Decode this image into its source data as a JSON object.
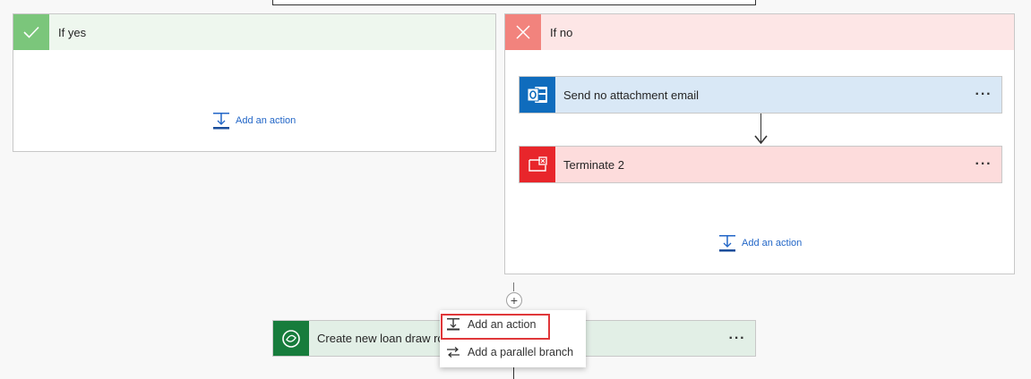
{
  "branches": {
    "yes": {
      "title": "If yes",
      "add_action": "Add an action"
    },
    "no": {
      "title": "If no",
      "add_action": "Add an action",
      "actions": [
        {
          "title": "Send no attachment email",
          "icon": "outlook-icon"
        },
        {
          "title": "Terminate 2",
          "icon": "terminate-icon"
        }
      ]
    }
  },
  "next_step": {
    "title": "Create new loan draw row"
  },
  "context_menu": {
    "items": [
      {
        "label": "Add an action"
      },
      {
        "label": "Add a parallel branch"
      }
    ]
  },
  "more_options_label": "···",
  "insert_step_label": "+",
  "colors": {
    "yes_header": "#eef7ee",
    "yes_icon": "#7bc67b",
    "no_header": "#fde6e6",
    "no_icon": "#f2837d",
    "outlook_card": "#d9e8f6",
    "outlook_icon": "#0f6cbd",
    "terminate_card": "#fddcdc",
    "terminate_icon": "#e8262b",
    "dataverse_card": "#e2efe6",
    "dataverse_icon": "#177c3c",
    "link": "#2266c7",
    "highlight": "#e0373a"
  }
}
